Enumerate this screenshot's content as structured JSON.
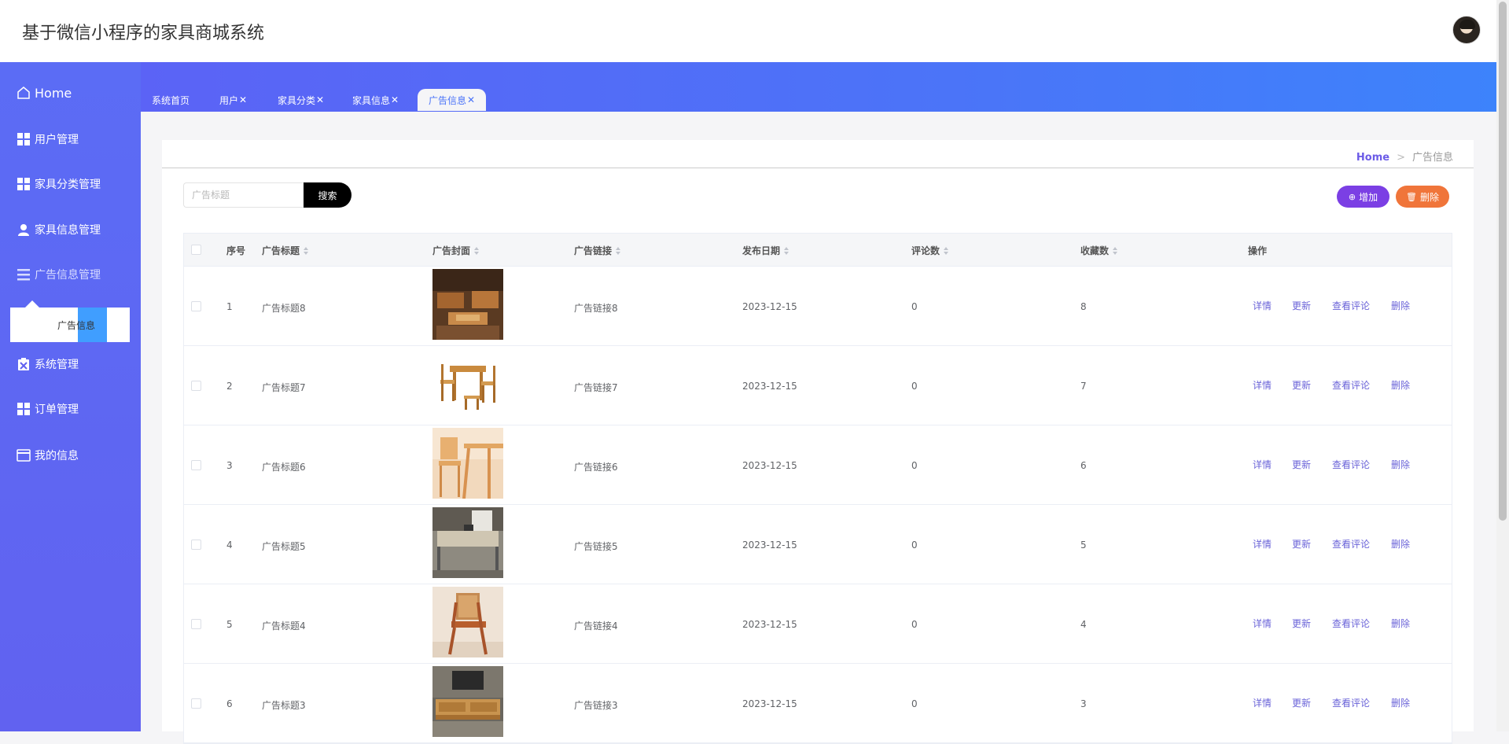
{
  "app": {
    "title": "基于微信小程序的家具商城系统"
  },
  "sidebar": {
    "home": "Home",
    "items": [
      {
        "label": "用户管理",
        "icon": "grid-icon"
      },
      {
        "label": "家具分类管理",
        "icon": "grid-icon"
      },
      {
        "label": "家具信息管理",
        "icon": "user-icon"
      },
      {
        "label": "广告信息管理",
        "icon": "list-icon"
      },
      {
        "label": "系统管理",
        "icon": "clipboard-icon"
      },
      {
        "label": "订单管理",
        "icon": "grid-icon"
      },
      {
        "label": "我的信息",
        "icon": "card-icon"
      }
    ],
    "submenu_label": "广告信息"
  },
  "tabs": [
    {
      "label": "系统首页",
      "closable": false
    },
    {
      "label": "用户",
      "closable": true
    },
    {
      "label": "家具分类",
      "closable": true
    },
    {
      "label": "家具信息",
      "closable": true
    },
    {
      "label": "广告信息",
      "closable": true,
      "active": true
    }
  ],
  "tab_close_glyph": "✕",
  "breadcrumb": {
    "home": "Home",
    "sep": ">",
    "current": "广告信息"
  },
  "search": {
    "placeholder": "广告标题",
    "button": "搜索"
  },
  "actions": {
    "add": "增加",
    "delete": "删除"
  },
  "table": {
    "headers": {
      "index": "序号",
      "title": "广告标题",
      "cover": "广告封面",
      "link": "广告链接",
      "date": "发布日期",
      "comments": "评论数",
      "favorites": "收藏数",
      "ops": "操作"
    },
    "ops": {
      "detail": "详情",
      "update": "更新",
      "comments": "查看评论",
      "delete": "删除"
    },
    "rows": [
      {
        "index": "1",
        "title": "广告标题8",
        "link": "广告链接8",
        "date": "2023-12-15",
        "comments": "0",
        "favorites": "8",
        "cover": "sofa-set"
      },
      {
        "index": "2",
        "title": "广告标题7",
        "link": "广告链接7",
        "date": "2023-12-15",
        "comments": "0",
        "favorites": "7",
        "cover": "dining-set"
      },
      {
        "index": "3",
        "title": "广告标题6",
        "link": "广告链接6",
        "date": "2023-12-15",
        "comments": "0",
        "favorites": "6",
        "cover": "desk-chair"
      },
      {
        "index": "4",
        "title": "广告标题5",
        "link": "广告链接5",
        "date": "2023-12-15",
        "comments": "0",
        "favorites": "5",
        "cover": "office-desk"
      },
      {
        "index": "5",
        "title": "广告标题4",
        "link": "广告链接4",
        "date": "2023-12-15",
        "comments": "0",
        "favorites": "4",
        "cover": "cane-chair"
      },
      {
        "index": "6",
        "title": "广告标题3",
        "link": "广告链接3",
        "date": "2023-12-15",
        "comments": "0",
        "favorites": "3",
        "cover": "tv-cabinet"
      }
    ]
  }
}
